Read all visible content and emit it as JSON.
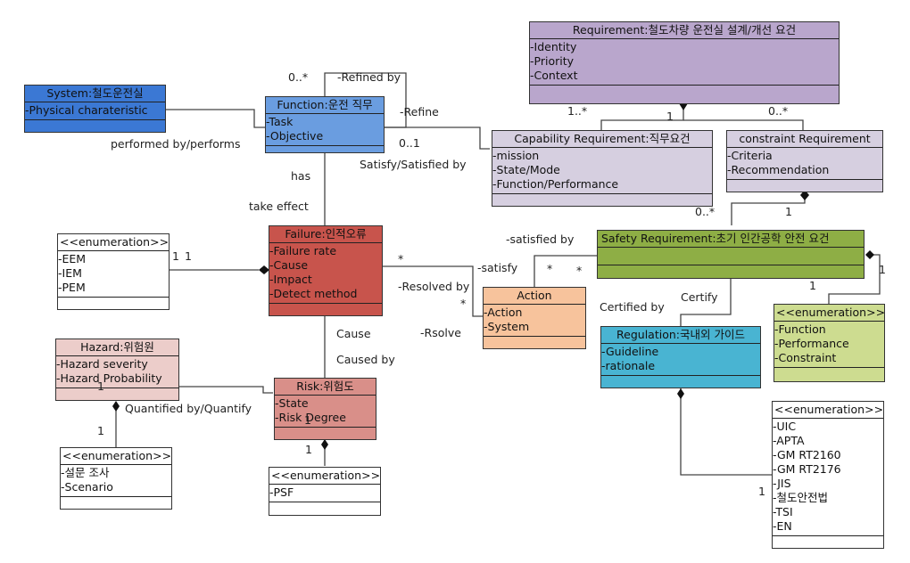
{
  "classes": {
    "requirement": {
      "title": "Requirement:철도차량 운전실 설계/개선 요건",
      "attrs": [
        "Identity",
        "Priority",
        "Context"
      ],
      "color": "#b9a6cc"
    },
    "system": {
      "title": "System:철도운전실",
      "attrs": [
        "Physical charateristic"
      ],
      "color": "#3b78d4"
    },
    "function": {
      "title": "Function:운전 직무",
      "attrs": [
        "Task",
        "Objective"
      ],
      "color": "#6a9de0"
    },
    "capability": {
      "title": "Capability Requirement:직무요건",
      "attrs": [
        "mission",
        "State/Mode",
        "Function/Performance"
      ],
      "color": "#d6cfe0"
    },
    "constraint": {
      "title": "constraint Requirement",
      "attrs": [
        "Criteria",
        "Recommendation"
      ],
      "color": "#d6cfe0"
    },
    "safety": {
      "title": "Safety Requirement:초기 인간공학 안전 요건",
      "attrs": [],
      "color": "#8eae45"
    },
    "failure": {
      "title": "Failure:인적오류",
      "attrs": [
        "Failure rate",
        "Cause",
        "Impact",
        "Detect method"
      ],
      "color": "#c8544c"
    },
    "enum_error": {
      "title": "<<enumeration>>",
      "attrs": [
        "EEM",
        "IEM",
        "PEM"
      ],
      "color": "#ffffff"
    },
    "action": {
      "title": "Action",
      "attrs": [
        "Action",
        "System"
      ],
      "color": "#f7c39c"
    },
    "enum_safety": {
      "title": "<<enumeration>>",
      "attrs": [
        "Function",
        "Performance",
        "Constraint"
      ],
      "color": "#cddc90"
    },
    "regulation": {
      "title": "Regulation:국내외 가이드",
      "attrs": [
        "Guideline",
        "rationale"
      ],
      "color": "#49b4d2"
    },
    "hazard": {
      "title": "Hazard:위험원",
      "attrs": [
        "Hazard severity",
        "Hazard Probability"
      ],
      "color": "#eccdca"
    },
    "risk": {
      "title": "Risk:위험도",
      "attrs": [
        "State",
        "Risk Degree"
      ],
      "color": "#d98f89"
    },
    "enum_hazard": {
      "title": "<<enumeration>>",
      "attrs": [
        "설문 조사",
        "Scenario"
      ],
      "color": "#ffffff"
    },
    "enum_risk": {
      "title": "<<enumeration>>",
      "attrs": [
        "PSF"
      ],
      "color": "#ffffff"
    },
    "enum_regulation": {
      "title": "<<enumeration>>",
      "attrs": [
        "UIC",
        "APTA",
        "GM RT2160",
        "GM RT2176",
        "JIS",
        "철도안전법",
        "TSI",
        "EN"
      ],
      "color": "#ffffff"
    }
  },
  "labels": {
    "req_cap_mult": "1..*",
    "req_comp_mult": "1",
    "req_con_mult": "0..*",
    "refine_mult": "0..*",
    "refined_by": "-Refined by",
    "refine": "-Refine",
    "performed_by": "performed by/performs",
    "func_cap_mult": "0..1",
    "satisfy_satisfied": "Satisfy/Satisfied by",
    "has": "has",
    "take_effect": "take effect",
    "cap_safety_mult": "0..*",
    "con_safety_mult": "1",
    "satisfied_by": "-satisfied by",
    "satisfy": "-satisfy",
    "star1": "*",
    "star2": "*",
    "enum_fail_mult_a": "1",
    "enum_fail_mult_b": "1",
    "fail_star": "*",
    "resolved_by": "-Resolved by",
    "action_star": "*",
    "rsolve": "-Rsolve",
    "certified_by": "Certified by",
    "certify": "Certify",
    "safety_mult_1": "1",
    "safety_mult_2": "1",
    "cause": "Cause",
    "caused_by": "Caused by",
    "hazard_mult": "1",
    "quantified": "Quantified by/Quantify",
    "hazard_enum_mult": "1",
    "risk_mult": "1",
    "risk_enum_mult": "1",
    "reg_enum_mult": "1"
  }
}
